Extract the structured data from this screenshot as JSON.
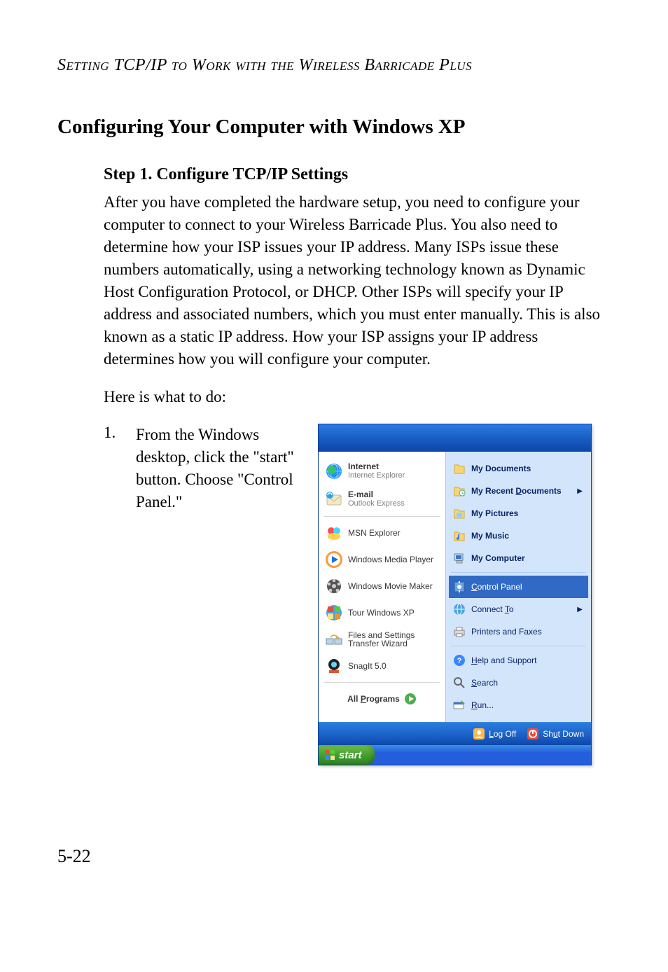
{
  "header": {
    "running_head": "Setting TCP/IP to Work with the Wireless Barricade Plus"
  },
  "section_title": "Configuring Your Computer with Windows XP",
  "step": {
    "heading": "Step 1. Configure TCP/IP Settings",
    "body": "After you have completed the hardware setup, you need to configure your computer to connect to your Wireless Barricade Plus. You also need to determine how your ISP issues your IP address. Many ISPs issue these numbers automatically, using a networking technology known as Dynamic Host Configuration Protocol, or DHCP. Other ISPs will specify your IP address and associated numbers, which you must enter manually. This is also known as a static IP address. How your ISP assigns your IP address determines how you will configure your computer.",
    "lead_in": "Here is what to do:",
    "list": {
      "num": "1.",
      "text": "From the Windows desktop, click the \"start\" button. Choose \"Control Panel.\""
    }
  },
  "page_number": "5-22",
  "start_menu": {
    "left_pinned": [
      {
        "title": "Internet",
        "sub": "Internet Explorer",
        "icon": "internet-icon"
      },
      {
        "title": "E-mail",
        "sub": "Outlook Express",
        "icon": "email-icon"
      }
    ],
    "left_recent": [
      {
        "label": "MSN Explorer",
        "icon": "msn-icon"
      },
      {
        "label": "Windows Media Player",
        "icon": "wmp-icon"
      },
      {
        "label": "Windows Movie Maker",
        "icon": "wmm-icon"
      },
      {
        "label": "Tour Windows XP",
        "icon": "tour-icon"
      },
      {
        "label": "Files and Settings Transfer Wizard",
        "icon": "fstw-icon"
      },
      {
        "label": "SnagIt 5.0",
        "icon": "snagit-icon"
      }
    ],
    "all_programs": "All Programs",
    "right_top": [
      {
        "label": "My Documents",
        "bold": true,
        "icon": "mydocs-icon",
        "submenu": false
      },
      {
        "label": "My Recent Documents",
        "bold": true,
        "icon": "recent-icon",
        "submenu": true,
        "mn": "D"
      },
      {
        "label": "My Pictures",
        "bold": true,
        "icon": "pictures-icon",
        "submenu": false
      },
      {
        "label": "My Music",
        "bold": true,
        "icon": "music-icon",
        "submenu": false
      },
      {
        "label": "My Computer",
        "bold": true,
        "icon": "computer-icon",
        "submenu": false
      }
    ],
    "right_mid": [
      {
        "label": "Control Panel",
        "icon": "control-panel-icon",
        "mn": "C",
        "highlight": true
      },
      {
        "label": "Connect To",
        "icon": "connect-icon",
        "mn": "T",
        "submenu": true
      },
      {
        "label": "Printers and Faxes",
        "icon": "printers-icon"
      }
    ],
    "right_bot": [
      {
        "label": "Help and Support",
        "icon": "help-icon",
        "mn": "H"
      },
      {
        "label": "Search",
        "icon": "search-icon",
        "mn": "S"
      },
      {
        "label": "Run...",
        "icon": "run-icon",
        "mn": "R"
      }
    ],
    "bottom": {
      "logoff": "Log Off",
      "shutdown": "Shut Down",
      "logoff_mn": "L",
      "shutdown_mn": "u"
    },
    "start_button": "start"
  }
}
